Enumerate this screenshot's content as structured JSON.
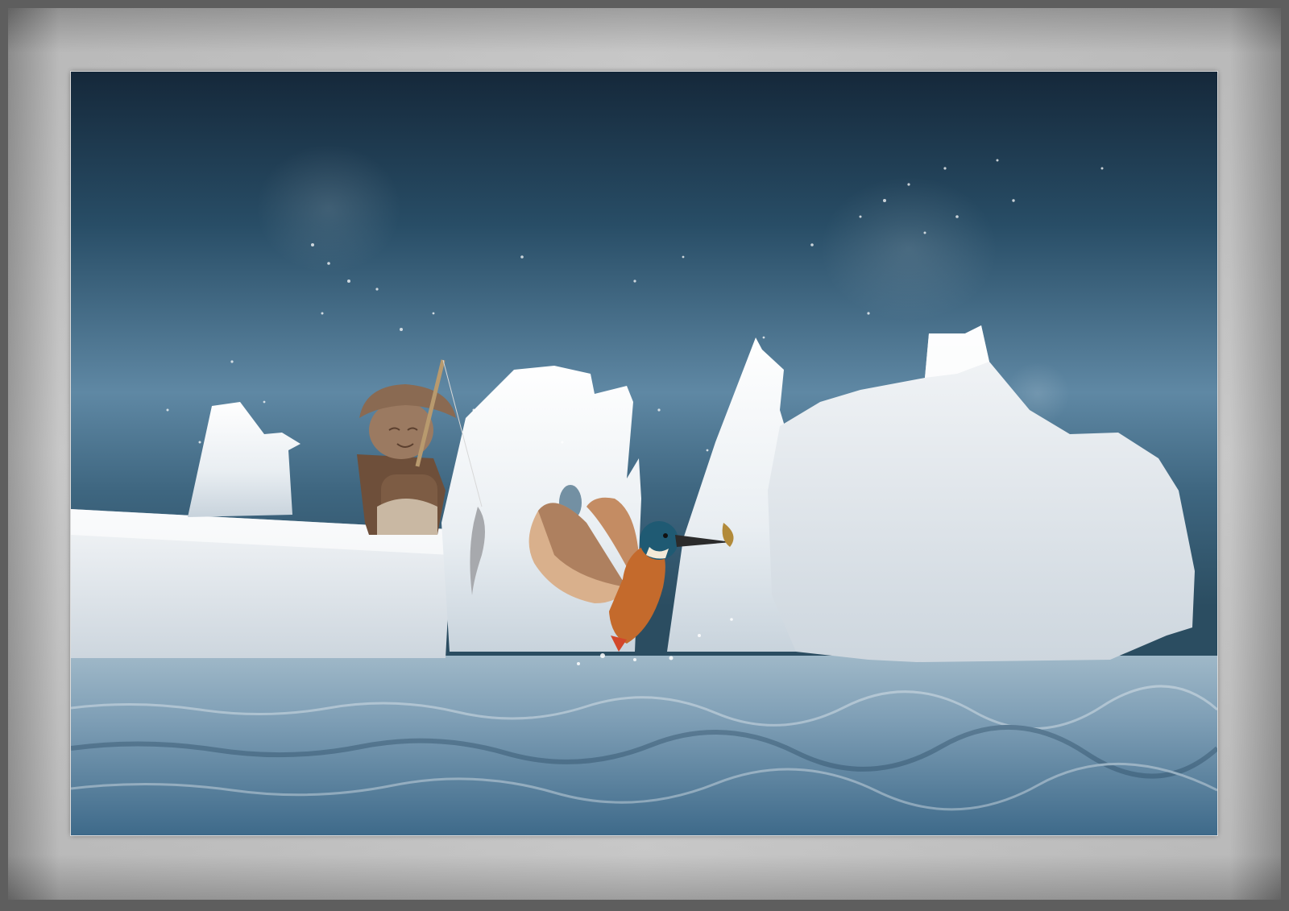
{
  "frame": {
    "mat_color_outer": "#5a5a5a",
    "mat_color_mid": "#bdbdbd",
    "mat_color_light": "#d8d8d8"
  },
  "scene": {
    "sky_top": "#16293a",
    "sky_mid": "#2f5670",
    "water_back": "#8aa7bb",
    "ice_color": "#eef3f6",
    "kingfisher_orange": "#c46a2c",
    "kingfisher_blue": "#1f5a73",
    "figurine_brown": "#7d5c44"
  }
}
